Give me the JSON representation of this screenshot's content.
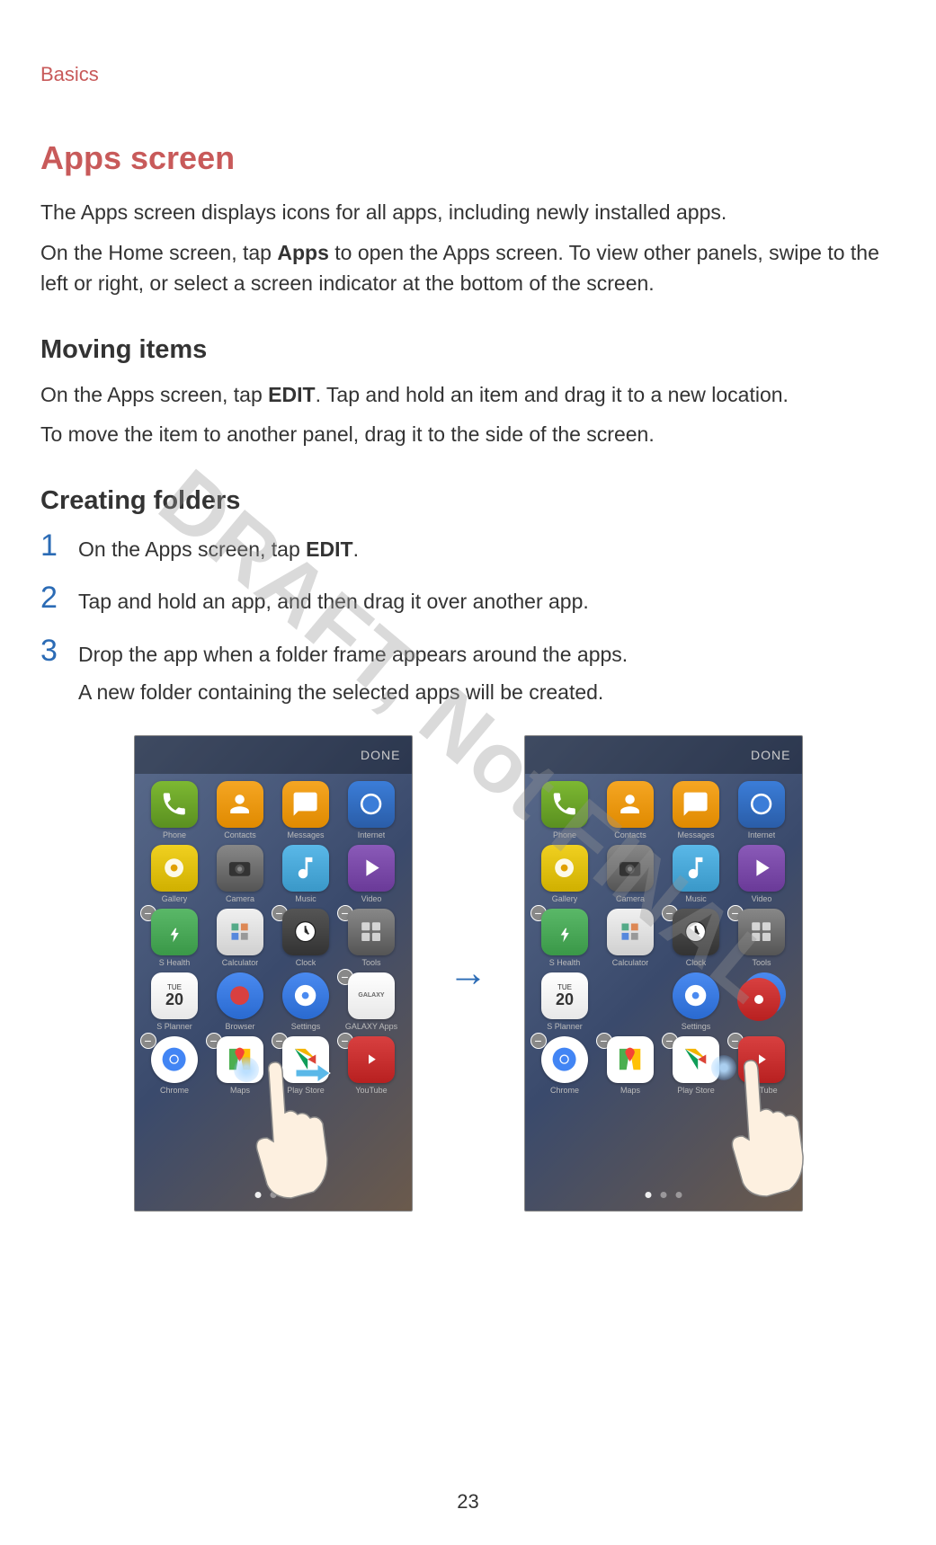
{
  "header": {
    "chapter": "Basics"
  },
  "section": {
    "title": "Apps screen",
    "intro1": "The Apps screen displays icons for all apps, including newly installed apps.",
    "intro2_pre": "On the Home screen, tap ",
    "intro2_bold": "Apps",
    "intro2_post": " to open the Apps screen. To view other panels, swipe to the left or right, or select a screen indicator at the bottom of the screen."
  },
  "moving": {
    "heading": "Moving items",
    "p1_pre": "On the Apps screen, tap ",
    "p1_bold": "EDIT",
    "p1_post": ". Tap and hold an item and drag it to a new location.",
    "p2": "To move the item to another panel, drag it to the side of the screen."
  },
  "creating": {
    "heading": "Creating folders",
    "steps": [
      {
        "num": "1",
        "pre": "On the Apps screen, tap ",
        "bold": "EDIT",
        "post": "."
      },
      {
        "num": "2",
        "text": "Tap and hold an app, and then drag it over another app."
      },
      {
        "num": "3",
        "text": "Drop the app when a folder frame appears around the apps.",
        "note": "A new folder containing the selected apps will be created."
      }
    ]
  },
  "phone": {
    "done_label": "DONE",
    "cal_day": "TUE",
    "cal_date": "20",
    "apps": {
      "phone": "Phone",
      "contacts": "Contacts",
      "messages": "Messages",
      "internet": "Internet",
      "gallery": "Gallery",
      "camera": "Camera",
      "music": "Music",
      "video": "Video",
      "health": "S Health",
      "calc": "Calculator",
      "clock": "Clock",
      "tools": "Tools",
      "planner": "S Planner",
      "browser": "Browser",
      "settings": "Settings",
      "galaxy": "GALAXY Apps",
      "chrome": "Chrome",
      "maps": "Maps",
      "play": "Play Store",
      "youtube": "YouTube"
    }
  },
  "watermark": "DRAFT, Not FINAL",
  "page_number": "23"
}
